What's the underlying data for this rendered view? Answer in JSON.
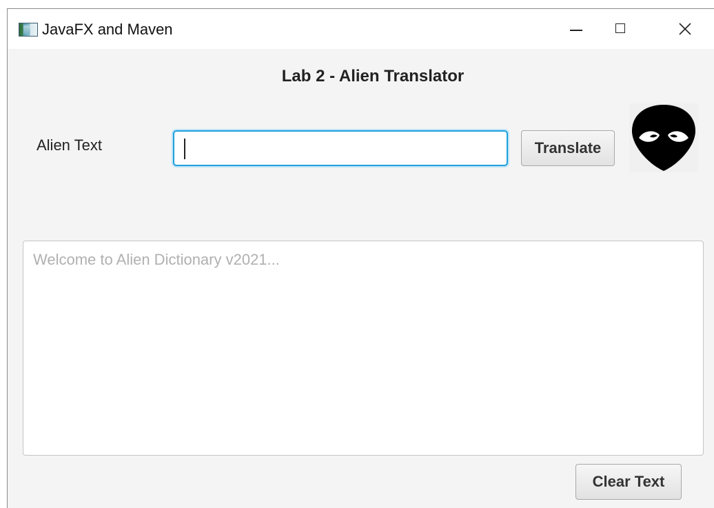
{
  "window": {
    "title": "JavaFX and Maven",
    "icon": "javafx-app-icon",
    "controls": {
      "minimize_icon": "minimize-icon",
      "maximize_icon": "maximize-icon",
      "close_icon": "close-icon"
    }
  },
  "main": {
    "heading": "Lab 2 - Alien Translator",
    "alien_text_label": "Alien Text",
    "alien_text_input": {
      "value": "",
      "placeholder": ""
    },
    "translate_button": "Translate",
    "alien_image_icon": "alien-head-icon",
    "output": {
      "value": "",
      "placeholder": "Welcome to Alien Dictionary v2021..."
    },
    "clear_button": "Clear Text"
  },
  "colors": {
    "focus_accent": "#1ea0dc",
    "window_background": "#f4f4f4"
  }
}
